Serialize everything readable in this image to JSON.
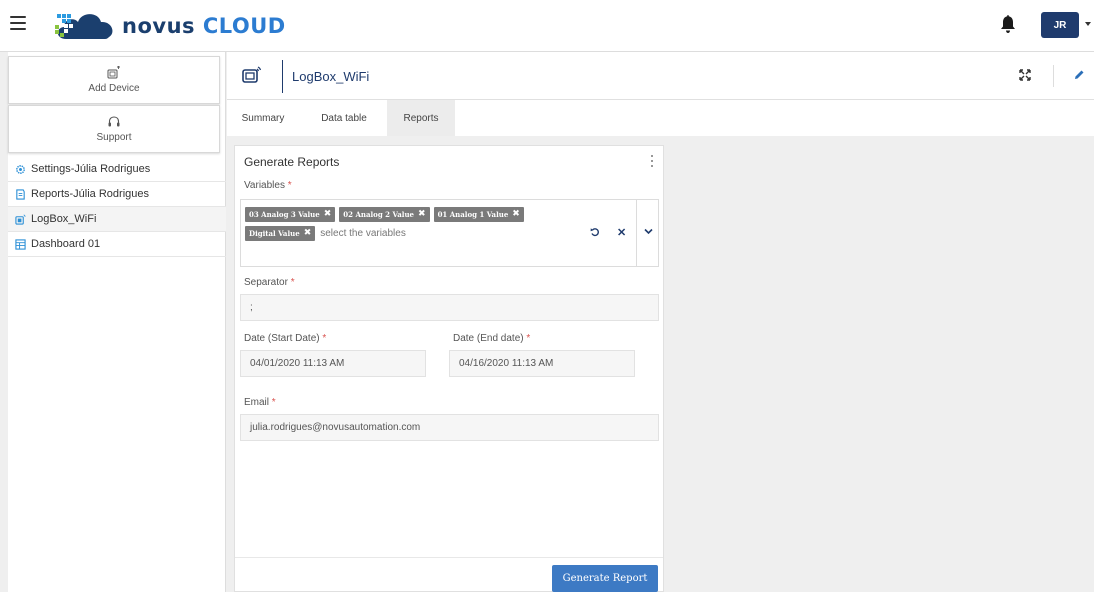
{
  "app": {
    "logo_part1": "novus",
    "logo_part2": "cloud",
    "user_initials": "JR",
    "brand_color": "#1f3b6d",
    "accent_color": "#3d7ac4"
  },
  "sidebar": {
    "add_device_label": "Add Device",
    "support_label": "Support",
    "items": [
      {
        "label": "Settings-Júlia Rodrigues",
        "icon": "gear-icon"
      },
      {
        "label": "Reports-Júlia Rodrigues",
        "icon": "report-icon"
      },
      {
        "label": "LogBox_WiFi",
        "icon": "device-icon"
      },
      {
        "label": "Dashboard 01",
        "icon": "dashboard-icon"
      }
    ]
  },
  "device": {
    "title": "LogBox_WiFi"
  },
  "tabs": [
    {
      "label": "Summary"
    },
    {
      "label": "Data table"
    },
    {
      "label": "Reports",
      "active": true
    }
  ],
  "form": {
    "title": "Generate Reports",
    "variables_label": "Variables",
    "required_mark": "*",
    "chips": [
      "03 Analog 3 Value",
      "02 Analog 2 Value",
      "01 Analog 1 Value",
      "Digital Value"
    ],
    "variables_placeholder": "select the variables",
    "separator_label": "Separator",
    "separator_value": ";",
    "start_date_label": "Date (Start Date)",
    "start_date_value": "04/01/2020 11:13 AM",
    "end_date_label": "Date (End date)",
    "end_date_value": "04/16/2020 11:13 AM",
    "email_label": "Email",
    "email_value": "julia.rodrigues@novusautomation.com",
    "generate_button": "Generate Report"
  }
}
